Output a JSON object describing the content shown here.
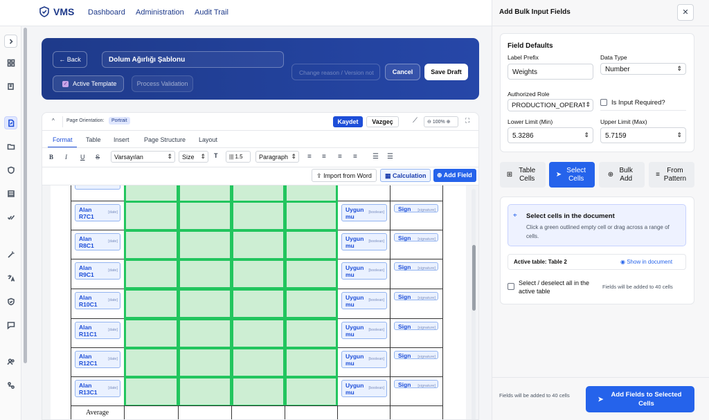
{
  "app": {
    "name": "VMS",
    "nav": [
      "Dashboard",
      "Administration",
      "Audit Trail"
    ]
  },
  "header": {
    "back": "← Back",
    "title": "Dolum Ağırlığı Şablonu",
    "reason_placeholder": "Change reason / Version not",
    "cancel": "Cancel",
    "save": "Save Draft",
    "active_template": "Active Template",
    "process_validation": "Process Validation"
  },
  "doc": {
    "orientation_label": "Page Orientation:",
    "orientation": "Portrait",
    "kaydet": "Kaydet",
    "vazgec": "Vazgeç",
    "zoom": "100%",
    "tabs": [
      "Format",
      "Table",
      "Insert",
      "Page Structure",
      "Layout"
    ],
    "font": "Varsayılan",
    "size": "Size",
    "line_height": "1.5",
    "style": "Paragraph",
    "import": "Import from Word",
    "calculation": "Calculation",
    "add_field": "Add Field",
    "rows": [
      {
        "alan": "Alan",
        "id": "R7C1"
      },
      {
        "alan": "Alan",
        "id": "R8C1"
      },
      {
        "alan": "Alan",
        "id": "R9C1"
      },
      {
        "alan": "Alan",
        "id": "R10C1"
      },
      {
        "alan": "Alan",
        "id": "R11C1"
      },
      {
        "alan": "Alan",
        "id": "R12C1"
      },
      {
        "alan": "Alan",
        "id": "R13C1"
      }
    ],
    "type_date": "[date]",
    "uygun": "Uygun",
    "mu": "mu",
    "type_bool": "[boolean]",
    "sign": "Sign",
    "type_sig": "[signature]",
    "average": "Average"
  },
  "panel": {
    "title": "Add Bulk Input Fields",
    "defaults": "Field Defaults",
    "label_prefix": "Label Prefix",
    "label_prefix_val": "Weights",
    "data_type": "Data Type",
    "data_type_val": "Number",
    "auth_role": "Authorized Role",
    "auth_role_val": "PRODUCTION_OPERAT",
    "input_required": "Is Input Required?",
    "lower": "Lower Limit (Min)",
    "lower_val": "5.3286",
    "upper": "Upper Limit (Max)",
    "upper_val": "5.7159",
    "modes": [
      "Table Cells",
      "Select Cells",
      "Bulk Add",
      "From Pattern"
    ],
    "select_title": "Select cells in the document",
    "select_desc": "Click a green outlined empty cell or drag across a range of cells.",
    "active_table": "Active table: Table 2",
    "show": "Show in document",
    "select_all": "Select / deselect all in the active table",
    "fields_count": "Fields will be added to 40 cells",
    "footer_note": "Fields will be added to 40 cells",
    "add_btn": "Add Fields to Selected Cells"
  },
  "colors": {
    "primary": "#2563eb",
    "navy": "#1e3a8a",
    "green": "#22c55e"
  }
}
